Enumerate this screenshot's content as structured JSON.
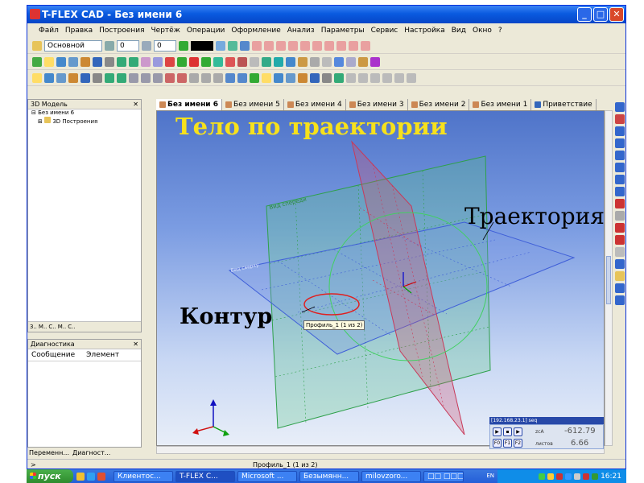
{
  "window": {
    "title": "T-FLEX CAD - Без имени 6",
    "min_label": "_",
    "max_label": "□",
    "close_label": "✕"
  },
  "menubar": {
    "items": [
      "Файл",
      "Правка",
      "Построения",
      "Чертёж",
      "Операции",
      "Оформление",
      "Анализ",
      "Параметры",
      "Сервис",
      "Настройка",
      "Вид",
      "Окно",
      "?"
    ]
  },
  "toolbar1": {
    "style_combo": "Основной",
    "layer_value": "0",
    "level_value": "0"
  },
  "model_panel": {
    "title": "3D Модель",
    "close": "✕",
    "tree": [
      "Без имени 6",
      "3D Построения"
    ],
    "tabs": [
      "3..",
      "M..",
      "C..",
      "M..",
      "C.."
    ]
  },
  "diag_panel": {
    "title": "Диагностика",
    "close": "✕",
    "col_message": "Сообщение",
    "col_element": "Элемент"
  },
  "bottom_tabs": [
    "Переменн...",
    "Диагност..."
  ],
  "doc_tabs": [
    {
      "label": "Без имени 6",
      "active": true
    },
    {
      "label": "Без имени 5",
      "active": false
    },
    {
      "label": "Без имени 4",
      "active": false
    },
    {
      "label": "Без имени 3",
      "active": false
    },
    {
      "label": "Без имени 2",
      "active": false
    },
    {
      "label": "Без имени 1",
      "active": false
    },
    {
      "label": "Приветствие",
      "active": false
    }
  ],
  "viewport": {
    "overlay_title": "Тело по траектории",
    "label_contour": "Контур",
    "label_trajectory": "Траектория",
    "tooltip": "Профиль_1 (1 из 2)",
    "plane_front_label": "Вид спереди",
    "plane_top_label": "Вид сверху"
  },
  "coord_panel": {
    "ip": "[192.168.23.1] seq",
    "value1": "-612.79",
    "value2": "6.66",
    "label_zoom": "zcA",
    "label_sheets": "листов",
    "buttons": [
      "F0",
      "F1",
      "F2"
    ]
  },
  "statusbar": {
    "left": ">",
    "center": "Профиль_1 (1 из 2)"
  },
  "taskbar": {
    "start": "пуск",
    "items": [
      "Клиентос...",
      "T-FLEX C...",
      "Microsoft ...",
      "Безымянн...",
      "milovzoro...",
      "□□ □□□..."
    ],
    "lang": "EN",
    "clock": "16:21"
  },
  "colors": {
    "accent": "#0a5be0",
    "viewport_top": "#4f74c9",
    "title_yellow": "#f7e11b",
    "plane_green": "#2ea04a",
    "plane_red": "#c83a5a",
    "plane_blue": "#3f5fd8"
  }
}
